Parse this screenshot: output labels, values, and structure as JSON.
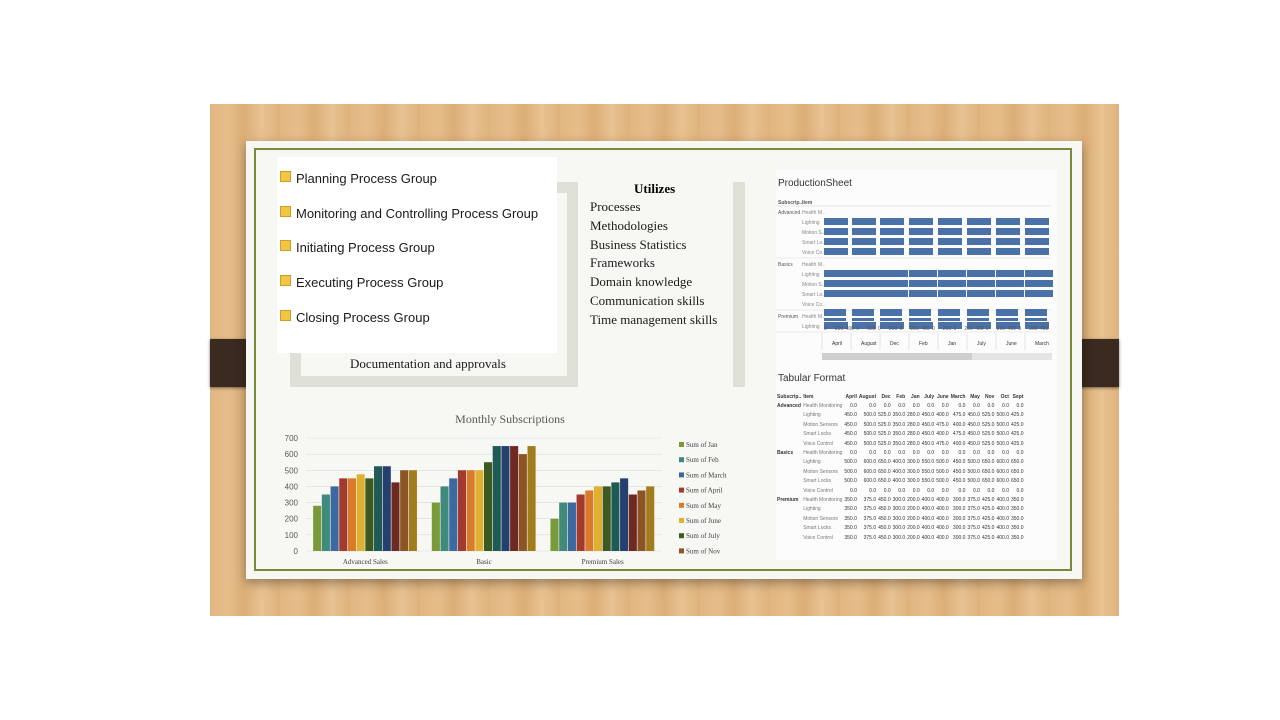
{
  "process_groups": [
    {
      "label": "Planning Process Group"
    },
    {
      "label": "Monitoring and Controlling Process Group"
    },
    {
      "label": "Initiating Process Group"
    },
    {
      "label": "Executing Process Group"
    },
    {
      "label": "Closing Process Group"
    }
  ],
  "documentation_label": "Documentation and approvals",
  "utilizes": {
    "title": "Utilizes",
    "items": [
      "Processes",
      "Methodologies",
      "Business Statistics",
      "Frameworks",
      "Domain knowledge",
      "Communication skills",
      "Time management skills"
    ]
  },
  "chart_data": {
    "type": "bar",
    "title": "Monthly Subscriptions",
    "categories": [
      "Advanced Sales",
      "Basic",
      "Premium Sales"
    ],
    "ylim": [
      0,
      700
    ],
    "yticks": [
      0,
      100,
      200,
      300,
      400,
      500,
      600,
      700
    ],
    "legend_position": "right",
    "series": [
      {
        "name": "Sum of Jan",
        "color": "#7a9a3a",
        "values": [
          280,
          300,
          200
        ]
      },
      {
        "name": "Sum of Feb",
        "color": "#3f8a7d",
        "values": [
          350,
          400,
          300
        ]
      },
      {
        "name": "Sum of March",
        "color": "#3a6aa0",
        "values": [
          400,
          450,
          300
        ]
      },
      {
        "name": "Sum of April",
        "color": "#a33a2e",
        "values": [
          450,
          500,
          350
        ]
      },
      {
        "name": "Sum of May",
        "color": "#d97b2b",
        "values": [
          450,
          500,
          375
        ]
      },
      {
        "name": "Sum of June",
        "color": "#e0b030",
        "values": [
          475,
          500,
          400
        ]
      },
      {
        "name": "Sum of July",
        "color": "#3d5a22",
        "values": [
          450,
          550,
          400
        ]
      },
      {
        "name": "Sum of Aug",
        "color": "#1f5a55",
        "values": [
          525,
          650,
          425
        ]
      },
      {
        "name": "Sum of Sep",
        "color": "#25406e",
        "values": [
          525,
          650,
          450
        ]
      },
      {
        "name": "Sum of Oct",
        "color": "#6e2a22",
        "values": [
          425,
          650,
          350
        ]
      },
      {
        "name": "Sum of Nov",
        "color": "#8e5524",
        "values": [
          500,
          600,
          375
        ]
      },
      {
        "name": "Sum of Dec",
        "color": "#a07c1c",
        "values": [
          500,
          650,
          400
        ]
      }
    ],
    "legend_visible": [
      "Sum of Jan",
      "Sum of Feb",
      "Sum of March",
      "Sum of April",
      "Sum of May",
      "Sum of June",
      "Sum of July",
      "Sum of Nov"
    ]
  },
  "production_sheet": {
    "title": "ProductionSheet",
    "col_header_1": "Subscrip..",
    "col_header_2": "Item",
    "groups": [
      {
        "name": "Advanced",
        "items": [
          "Health M..",
          "Lighting",
          "Motion S..",
          "Smart Lo..",
          "Voice Co.."
        ]
      },
      {
        "name": "Basics",
        "items": [
          "Health M..",
          "Lighting",
          "Motion S..",
          "Smart Lo..",
          "Voice Co.."
        ]
      },
      {
        "name": "Premium",
        "items": [
          "Health M..",
          "Lighting"
        ]
      }
    ],
    "axis_ticks": [
      "0",
      "200",
      "400",
      "0",
      "500",
      "0",
      "500",
      "0",
      "200",
      "400",
      "0",
      "200",
      "0",
      "200",
      "400",
      "0",
      "200",
      "400",
      "0",
      "200",
      "400"
    ],
    "months": [
      "April",
      "August",
      "Dec",
      "Feb",
      "Jan",
      "July",
      "June",
      "March"
    ]
  },
  "tabular_format": {
    "title": "Tabular Format",
    "headers": [
      "Subscrip..",
      "Item",
      "April",
      "August",
      "Dec",
      "Feb",
      "Jan",
      "July",
      "June",
      "March",
      "May",
      "Nov",
      "Oct",
      "Sept"
    ],
    "rows": [
      {
        "group": "Advanced",
        "item": "Health Monitoring",
        "values": [
          "0.0",
          "0.0",
          "0.0",
          "0.0",
          "0.0",
          "0.0",
          "0.0",
          "0.0",
          "0.0",
          "0.0",
          "0.0",
          "0.0"
        ]
      },
      {
        "group": "",
        "item": "Lighting",
        "values": [
          "450.0",
          "500.0",
          "525.0",
          "350.0",
          "280.0",
          "450.0",
          "400.0",
          "475.0",
          "450.0",
          "525.0",
          "500.0",
          "425.0"
        ]
      },
      {
        "group": "",
        "item": "Motion Sensors",
        "values": [
          "450.0",
          "500.0",
          "525.0",
          "350.0",
          "280.0",
          "450.0",
          "475.0",
          "400.0",
          "450.0",
          "525.0",
          "500.0",
          "425.0"
        ]
      },
      {
        "group": "",
        "item": "Smart Locks",
        "values": [
          "450.0",
          "500.0",
          "525.0",
          "350.0",
          "280.0",
          "450.0",
          "400.0",
          "475.0",
          "450.0",
          "525.0",
          "500.0",
          "425.0"
        ]
      },
      {
        "group": "",
        "item": "Voice Control",
        "values": [
          "450.0",
          "500.0",
          "525.0",
          "350.0",
          "280.0",
          "450.0",
          "475.0",
          "400.0",
          "450.0",
          "525.0",
          "500.0",
          "425.0"
        ]
      },
      {
        "group": "Basics",
        "item": "Health Monitoring",
        "values": [
          "0.0",
          "0.0",
          "0.0",
          "0.0",
          "0.0",
          "0.0",
          "0.0",
          "0.0",
          "0.0",
          "0.0",
          "0.0",
          "0.0"
        ]
      },
      {
        "group": "",
        "item": "Lighting",
        "values": [
          "500.0",
          "600.0",
          "650.0",
          "400.0",
          "300.0",
          "550.0",
          "500.0",
          "450.0",
          "500.0",
          "650.0",
          "600.0",
          "650.0"
        ]
      },
      {
        "group": "",
        "item": "Motion Sensors",
        "values": [
          "500.0",
          "600.0",
          "650.0",
          "400.0",
          "300.0",
          "550.0",
          "500.0",
          "450.0",
          "500.0",
          "650.0",
          "600.0",
          "650.0"
        ]
      },
      {
        "group": "",
        "item": "Smart Locks",
        "values": [
          "500.0",
          "600.0",
          "650.0",
          "400.0",
          "300.0",
          "550.0",
          "500.0",
          "450.0",
          "500.0",
          "650.0",
          "600.0",
          "650.0"
        ]
      },
      {
        "group": "",
        "item": "Voice Control",
        "values": [
          "0.0",
          "0.0",
          "0.0",
          "0.0",
          "0.0",
          "0.0",
          "0.0",
          "0.0",
          "0.0",
          "0.0",
          "0.0",
          "0.0"
        ]
      },
      {
        "group": "Premium",
        "item": "Health Monitoring",
        "values": [
          "350.0",
          "375.0",
          "450.0",
          "300.0",
          "200.0",
          "400.0",
          "400.0",
          "300.0",
          "375.0",
          "425.0",
          "400.0",
          "350.0"
        ]
      },
      {
        "group": "",
        "item": "Lighting",
        "values": [
          "350.0",
          "375.0",
          "450.0",
          "300.0",
          "200.0",
          "400.0",
          "400.0",
          "300.0",
          "375.0",
          "425.0",
          "400.0",
          "350.0"
        ]
      },
      {
        "group": "",
        "item": "Motion Sensors",
        "values": [
          "350.0",
          "375.0",
          "450.0",
          "300.0",
          "200.0",
          "400.0",
          "400.0",
          "300.0",
          "375.0",
          "425.0",
          "400.0",
          "350.0"
        ]
      },
      {
        "group": "",
        "item": "Smart Locks",
        "values": [
          "350.0",
          "375.0",
          "450.0",
          "300.0",
          "200.0",
          "400.0",
          "400.0",
          "300.0",
          "375.0",
          "425.0",
          "400.0",
          "350.0"
        ]
      },
      {
        "group": "",
        "item": "Voice Control",
        "values": [
          "350.0",
          "375.0",
          "450.0",
          "300.0",
          "200.0",
          "400.0",
          "400.0",
          "300.0",
          "375.0",
          "425.0",
          "400.0",
          "350.0"
        ]
      }
    ]
  },
  "colors": {
    "frame_border": "#7b8a3a",
    "bar_blue": "#4a72a8",
    "bullet_yellow": "#f4c542"
  }
}
